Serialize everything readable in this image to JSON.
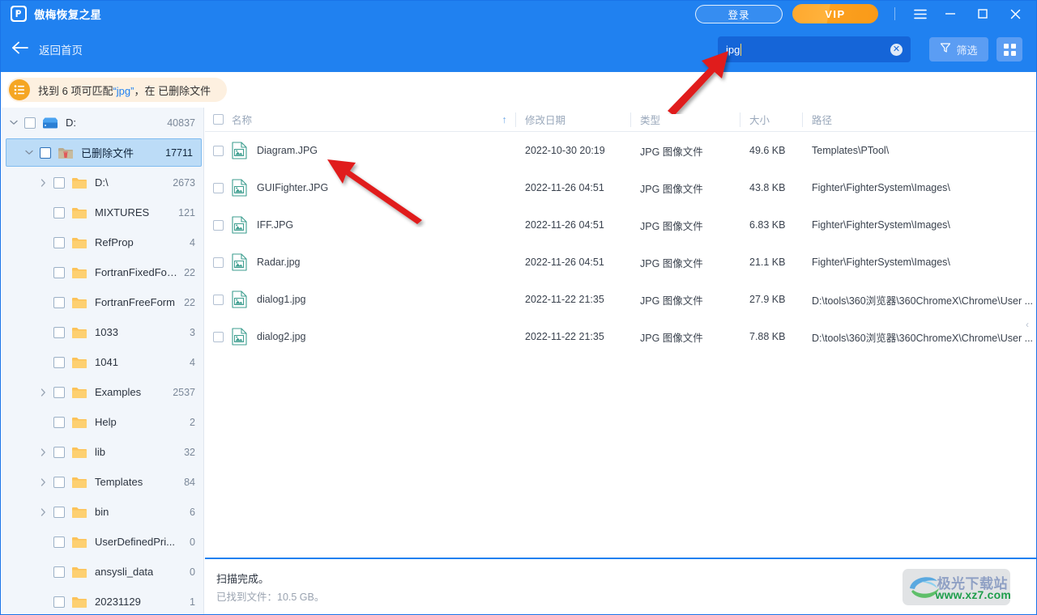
{
  "titlebar": {
    "app_title": "傲梅恢复之星",
    "login_label": "登录",
    "vip_label": "VIP",
    "menu_icon": "hamburger-menu-icon",
    "minimize_icon": "minimize-icon",
    "maximize_icon": "maximize-icon",
    "close_icon": "close-icon"
  },
  "subheader": {
    "back_label": "返回首页",
    "back_icon": "arrow-left-icon",
    "search_value": "jpg",
    "search_clear_icon": "clear-circle-icon",
    "filter_label": "筛选",
    "filter_icon": "funnel-icon",
    "grid_icon": "grid-view-icon"
  },
  "banner": {
    "icon": "list-icon",
    "prefix": "找到 6 项可匹配",
    "query": "“jpg”",
    "suffix": "，在 已删除文件",
    "match_count": 6
  },
  "dropdowns": [
    {
      "name": "type",
      "label": "类型"
    },
    {
      "name": "date",
      "label": "修改日期"
    },
    {
      "name": "size",
      "label": "大小"
    }
  ],
  "sidebar": {
    "items": [
      {
        "label": "D:",
        "count": "40837",
        "indent": 0,
        "twisty": "down",
        "icon": "drive-icon",
        "selected": false
      },
      {
        "label": "已删除文件",
        "count": "17711",
        "indent": 1,
        "twisty": "down",
        "icon": "trash-folder-icon",
        "selected": true
      },
      {
        "label": "D:\\",
        "count": "2673",
        "indent": 2,
        "twisty": "right",
        "icon": "folder-icon",
        "selected": false
      },
      {
        "label": "MIXTURES",
        "count": "121",
        "indent": 2,
        "twisty": "none",
        "icon": "folder-icon",
        "selected": false
      },
      {
        "label": "RefProp",
        "count": "4",
        "indent": 2,
        "twisty": "none",
        "icon": "folder-icon",
        "selected": false
      },
      {
        "label": "FortranFixedForm",
        "count": "22",
        "indent": 2,
        "twisty": "none",
        "icon": "folder-icon",
        "selected": false
      },
      {
        "label": "FortranFreeForm",
        "count": "22",
        "indent": 2,
        "twisty": "none",
        "icon": "folder-icon",
        "selected": false
      },
      {
        "label": "1033",
        "count": "3",
        "indent": 2,
        "twisty": "none",
        "icon": "folder-icon",
        "selected": false
      },
      {
        "label": "1041",
        "count": "4",
        "indent": 2,
        "twisty": "none",
        "icon": "folder-icon",
        "selected": false
      },
      {
        "label": "Examples",
        "count": "2537",
        "indent": 2,
        "twisty": "right",
        "icon": "folder-icon",
        "selected": false
      },
      {
        "label": "Help",
        "count": "2",
        "indent": 2,
        "twisty": "none",
        "icon": "folder-icon",
        "selected": false
      },
      {
        "label": "lib",
        "count": "32",
        "indent": 2,
        "twisty": "right",
        "icon": "folder-icon",
        "selected": false
      },
      {
        "label": "Templates",
        "count": "84",
        "indent": 2,
        "twisty": "right",
        "icon": "folder-icon",
        "selected": false
      },
      {
        "label": "bin",
        "count": "6",
        "indent": 2,
        "twisty": "right",
        "icon": "folder-icon",
        "selected": false
      },
      {
        "label": "UserDefinedPri...",
        "count": "0",
        "indent": 2,
        "twisty": "none",
        "icon": "folder-icon",
        "selected": false
      },
      {
        "label": "ansysli_data",
        "count": "0",
        "indent": 2,
        "twisty": "none",
        "icon": "folder-icon",
        "selected": false
      },
      {
        "label": "20231129",
        "count": "1",
        "indent": 2,
        "twisty": "none",
        "icon": "folder-icon",
        "selected": false
      }
    ]
  },
  "table": {
    "columns": {
      "name": "名称",
      "date": "修改日期",
      "type": "类型",
      "size": "大小",
      "path": "路径"
    },
    "sort_indicator": "↑",
    "rows": [
      {
        "name": "Diagram.JPG",
        "date": "2022-10-30 20:19",
        "type": "JPG 图像文件",
        "size": "49.6 KB",
        "path": "Templates\\PTool\\"
      },
      {
        "name": "GUIFighter.JPG",
        "date": "2022-11-26 04:51",
        "type": "JPG 图像文件",
        "size": "43.8 KB",
        "path": "Fighter\\FighterSystem\\Images\\"
      },
      {
        "name": "IFF.JPG",
        "date": "2022-11-26 04:51",
        "type": "JPG 图像文件",
        "size": "6.83 KB",
        "path": "Fighter\\FighterSystem\\Images\\"
      },
      {
        "name": "Radar.jpg",
        "date": "2022-11-26 04:51",
        "type": "JPG 图像文件",
        "size": "21.1 KB",
        "path": "Fighter\\FighterSystem\\Images\\"
      },
      {
        "name": "dialog1.jpg",
        "date": "2022-11-22 21:35",
        "type": "JPG 图像文件",
        "size": "27.9 KB",
        "path": "D:\\tools\\360浏览器\\360ChromeX\\Chrome\\User ..."
      },
      {
        "name": "dialog2.jpg",
        "date": "2022-11-22 21:35",
        "type": "JPG 图像文件",
        "size": "7.88 KB",
        "path": "D:\\tools\\360浏览器\\360ChromeX\\Chrome\\User ..."
      }
    ]
  },
  "status": {
    "line1": "扫描完成。",
    "line2": "已找到文件：10.5 GB。"
  },
  "collapse_handle": "‹",
  "watermark": {
    "title": "极光下载站",
    "url": "www.xz7.com"
  },
  "colors": {
    "brand_blue": "#2081f0",
    "vip_orange": "#fca01f",
    "selection_blue": "#bcdcf7",
    "banner_bg": "#fdf0e0",
    "banner_icon": "#f5a623",
    "file_icon_teal": "#3d9e8f",
    "annotation_red": "#e01b1b"
  }
}
